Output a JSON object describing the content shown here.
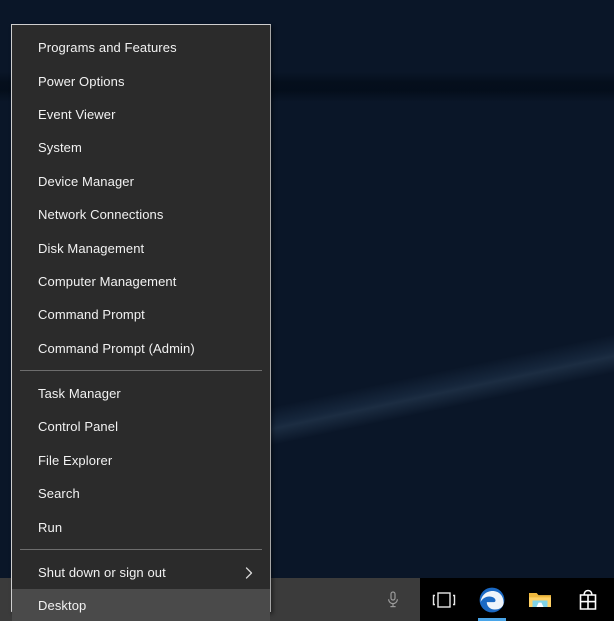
{
  "desktop": {
    "name": "windows-desktop-wallpaper",
    "accent_color": "#0c3c66"
  },
  "winx_menu": {
    "title": "Win+X Quick Link Menu",
    "groups": [
      {
        "items": [
          {
            "label": "Programs and Features",
            "name": "menu-item-programs-and-features",
            "selected": false,
            "submenu": false
          },
          {
            "label": "Power Options",
            "name": "menu-item-power-options",
            "selected": false,
            "submenu": false
          },
          {
            "label": "Event Viewer",
            "name": "menu-item-event-viewer",
            "selected": false,
            "submenu": false
          },
          {
            "label": "System",
            "name": "menu-item-system",
            "selected": false,
            "submenu": false
          },
          {
            "label": "Device Manager",
            "name": "menu-item-device-manager",
            "selected": false,
            "submenu": false
          },
          {
            "label": "Network Connections",
            "name": "menu-item-network-connections",
            "selected": false,
            "submenu": false
          },
          {
            "label": "Disk Management",
            "name": "menu-item-disk-management",
            "selected": false,
            "submenu": false
          },
          {
            "label": "Computer Management",
            "name": "menu-item-computer-management",
            "selected": false,
            "submenu": false
          },
          {
            "label": "Command Prompt",
            "name": "menu-item-command-prompt",
            "selected": false,
            "submenu": false
          },
          {
            "label": "Command Prompt (Admin)",
            "name": "menu-item-command-prompt-admin",
            "selected": false,
            "submenu": false
          }
        ]
      },
      {
        "items": [
          {
            "label": "Task Manager",
            "name": "menu-item-task-manager",
            "selected": false,
            "submenu": false
          },
          {
            "label": "Control Panel",
            "name": "menu-item-control-panel",
            "selected": false,
            "submenu": false
          },
          {
            "label": "File Explorer",
            "name": "menu-item-file-explorer",
            "selected": false,
            "submenu": false
          },
          {
            "label": "Search",
            "name": "menu-item-search",
            "selected": false,
            "submenu": false
          },
          {
            "label": "Run",
            "name": "menu-item-run",
            "selected": false,
            "submenu": false
          }
        ]
      },
      {
        "items": [
          {
            "label": "Shut down or sign out",
            "name": "menu-item-shut-down-or-sign-out",
            "selected": false,
            "submenu": true
          },
          {
            "label": "Desktop",
            "name": "menu-item-desktop",
            "selected": true,
            "submenu": false
          }
        ]
      }
    ]
  },
  "taskbar": {
    "search": {
      "value": "",
      "placeholder": "",
      "mic_icon": "microphone-icon"
    },
    "buttons": [
      {
        "name": "task-view-button",
        "icon": "task-view-icon",
        "label": "Task View",
        "active": false
      },
      {
        "name": "edge-browser-button",
        "icon": "edge-icon",
        "label": "Microsoft Edge",
        "active": true
      },
      {
        "name": "file-explorer-button",
        "icon": "file-explorer-icon",
        "label": "File Explorer",
        "active": false
      },
      {
        "name": "microsoft-store-button",
        "icon": "store-icon",
        "label": "Microsoft Store",
        "active": false
      }
    ],
    "accent_color": "#4aa5e8"
  }
}
